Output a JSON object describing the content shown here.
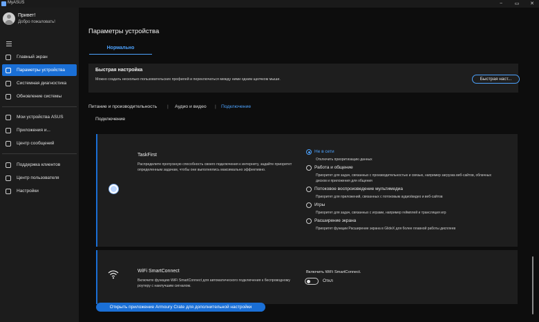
{
  "app": {
    "title": "MyASUS"
  },
  "window_controls": {
    "minimize": "−",
    "maximize": "▭",
    "close": "✕"
  },
  "user": {
    "greeting": "Привет!",
    "welcome": "Добро пожаловать!"
  },
  "sidebar": {
    "items": [
      {
        "label": "Главный экран",
        "icon": "home-icon"
      },
      {
        "label": "Параметры устройства",
        "icon": "sliders-icon",
        "active": true
      },
      {
        "label": "Системная диагностика",
        "icon": "diagnostics-icon"
      },
      {
        "label": "Обновление системы",
        "icon": "refresh-icon"
      },
      {
        "label": "Мои устройства ASUS",
        "icon": "devices-icon"
      },
      {
        "label": "Приложения и...",
        "icon": "apps-grid-icon"
      },
      {
        "label": "Центр сообщений",
        "icon": "message-icon"
      },
      {
        "label": "Поддержка клиентов",
        "icon": "support-icon"
      },
      {
        "label": "Центр пользователя",
        "icon": "user-icon"
      },
      {
        "label": "Настройки",
        "icon": "gear-icon"
      }
    ]
  },
  "main": {
    "page_title": "Параметры устройства",
    "mode_tab": "Нормально",
    "quick_settings": {
      "title": "Быстрая настройка",
      "description": "Можно создать несколько пользовательских профилей и переключаться между ними одним щелчком мыши.",
      "button": "Быстрая наст..."
    },
    "tabs": [
      {
        "label": "Питание и производительность"
      },
      {
        "label": "Аудио и видео"
      },
      {
        "label": "Подключение",
        "active": true
      }
    ],
    "section_label": "Подключение",
    "taskfirst": {
      "title": "TaskFirst",
      "description": "Распределите пропускную способность своего подключения к интернету, задайте приоритет определенным задачам, чтобы они выполнялись максимально эффективно.",
      "options": [
        {
          "label": "Не в сети",
          "desc": "Отключить приоритизацию данных",
          "selected": true
        },
        {
          "label": "Работа и общение",
          "desc": "Приоритет для задач, связанных с производительностью и связью, например загрузка веб-сайтов, облачных дисков и приложения для общения"
        },
        {
          "label": "Потоковое воспроизведение мультимедиа",
          "desc": "Приоритет для приложений, связанных с потоковым аудио/видео и веб-сайтов"
        },
        {
          "label": "Игры",
          "desc": "Приоритет для задач, связанных с играми, например геймплей и трансляция игр"
        },
        {
          "label": "Расширение экрана",
          "desc": "Приоритет функции Расширение экрана в GlideX для более плавной работы дисплеев"
        }
      ]
    },
    "wifi": {
      "title": "WiFi SmartConnect",
      "description": "Включите функцию WiFi SmartConnect для автоматического подключения к беспроводному роутеру с наилучшим сигналом.",
      "enable_label": "Включить WiFi SmartConnect.",
      "switch_state": "Откл"
    },
    "armoury_button": "Открыть приложение Armoury Crate для дополнительной настройки"
  },
  "colors": {
    "accent": "#1a6fd6",
    "accent_text": "#4da3ff",
    "card_bg": "#1e1e1e",
    "sidebar_bg": "#1c1c1c"
  }
}
